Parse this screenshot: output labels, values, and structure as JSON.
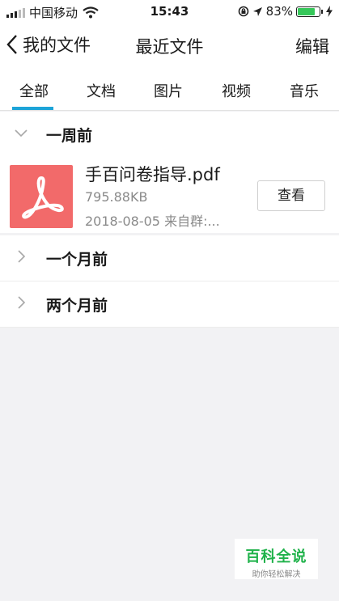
{
  "status_bar": {
    "carrier": "中国移动",
    "time": "15:43",
    "battery_percent": "83%",
    "battery_level": 0.83,
    "icons": [
      "signal-icon",
      "wifi-icon",
      "rotation-lock-icon",
      "location-icon",
      "battery-icon",
      "charging-icon"
    ]
  },
  "nav": {
    "back_label": "我的文件",
    "title": "最近文件",
    "edit_label": "编辑"
  },
  "tabs": [
    {
      "label": "全部",
      "selected": true
    },
    {
      "label": "文档",
      "selected": false
    },
    {
      "label": "图片",
      "selected": false
    },
    {
      "label": "视频",
      "selected": false
    },
    {
      "label": "音乐",
      "selected": false
    }
  ],
  "accent_color": "#1da4d8",
  "groups": [
    {
      "label": "一周前",
      "expanded": true
    },
    {
      "label": "一个月前",
      "expanded": false
    },
    {
      "label": "两个月前",
      "expanded": false
    }
  ],
  "file": {
    "name": "手百问卷指导.pdf",
    "size": "795.88KB",
    "meta": "2018-08-05 来自群:...",
    "action_label": "查看",
    "icon": "pdf-icon",
    "icon_color": "#f26a6a"
  },
  "watermark": {
    "title": "百科全说",
    "subtitle": "助你轻松解决"
  }
}
